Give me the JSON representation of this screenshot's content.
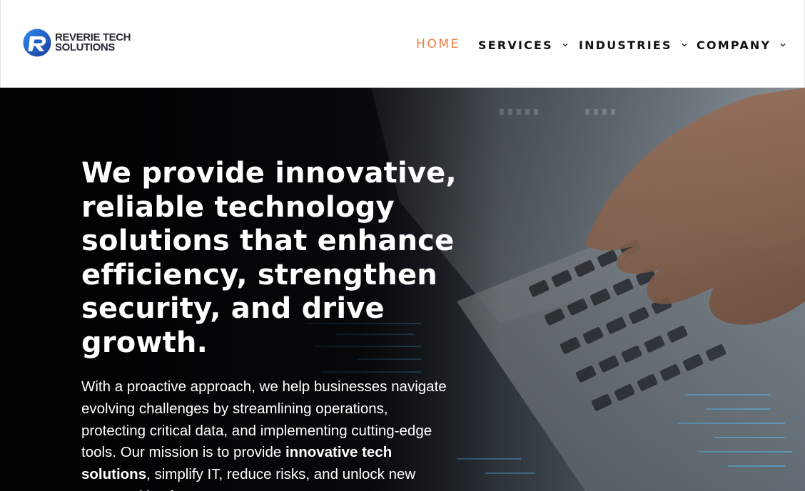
{
  "brand": {
    "name_line1": "REVERIE TECH",
    "name_line2": "SOLUTIONS",
    "logo_icon": "reverie-r-logo",
    "colors": {
      "logo_blue": "#1f6fd8",
      "logo_dark": "#1b2a6b"
    }
  },
  "nav": {
    "home": "HOME",
    "services": "SERVICES",
    "industries": "INDUSTRIES",
    "company": "COMPANY",
    "dropdown_icon": "chevron-down-icon",
    "colors": {
      "active": "#f07a42",
      "default": "#121212"
    }
  },
  "hero": {
    "title": "We provide innovative, reliable technology solutions that enhance efficiency, strengthen security, and drive growth.",
    "description_part1": "With a proactive approach, we help businesses navigate evolving challenges by streamlining operations, protecting critical data, and implementing cutting-edge tools. Our mission is to provide ",
    "description_bold": "innovative tech solutions",
    "description_part2": ", simplify IT, reduce risks, and unlock new opportunities for success.",
    "background": "hands-typing-on-laptop-with-data-overlay"
  }
}
